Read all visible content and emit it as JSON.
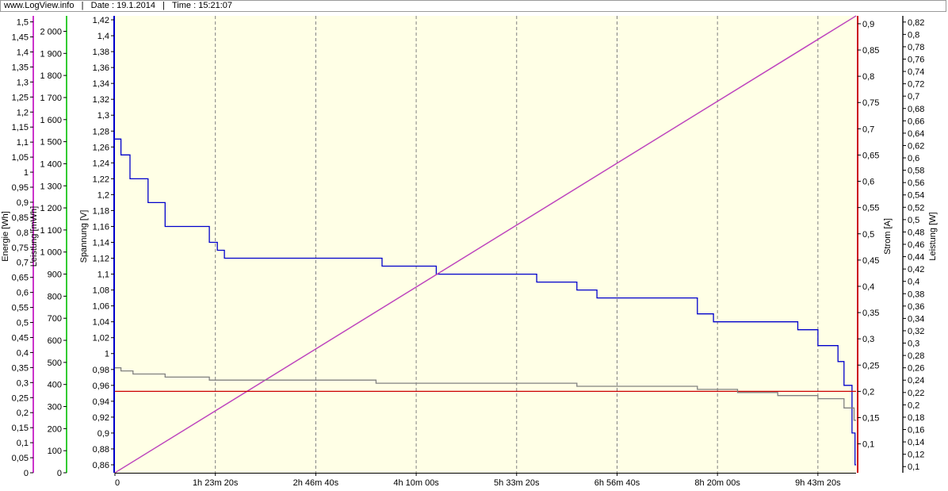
{
  "header": {
    "site": "www.LogView.info",
    "date_label": "Date : 19.1.2014",
    "time_label": "Time : 15:21:07"
  },
  "colors": {
    "plot_bg": "#ffffe6",
    "energie": "#cc33cc",
    "leistung_mwh": "#33cc33",
    "spannung": "#0000cc",
    "strom": "#cc0000",
    "leistung_w": "#808080",
    "grid": "#808080"
  },
  "chart_data": {
    "type": "line",
    "grid": "vertical dashed",
    "x_axis": {
      "tick_labels": [
        "0",
        "1h 23m 20s",
        "2h 46m 40s",
        "4h 10m 00s",
        "5h 33m 20s",
        "6h 56m 40s",
        "8h 20m 00s",
        "9h 43m 20s"
      ],
      "tick_seconds": [
        0,
        5000,
        10000,
        15000,
        20000,
        25000,
        30000,
        35000
      ],
      "range_seconds": [
        0,
        36900
      ]
    },
    "axes": {
      "energie": {
        "label": "Energie [Wh]",
        "range": [
          0,
          1.52
        ],
        "ticks": [
          "0",
          "0,05",
          "0,1",
          "0,15",
          "0,2",
          "0,25",
          "0,3",
          "0,35",
          "0,4",
          "0,45",
          "0,5",
          "0,55",
          "0,6",
          "0,65",
          "0,7",
          "0,75",
          "0,8",
          "0,85",
          "0,9",
          "0,95",
          "1",
          "1,05",
          "1,1",
          "1,15",
          "1,2",
          "1,25",
          "1,3",
          "1,35",
          "1,4",
          "1,45",
          "1,5"
        ]
      },
      "leistung_mwh": {
        "label": "Leistung [mWh]",
        "range": [
          0,
          2070
        ],
        "ticks": [
          "0",
          "100",
          "200",
          "300",
          "400",
          "500",
          "600",
          "700",
          "800",
          "900",
          "1 000",
          "1 100",
          "1 200",
          "1 300",
          "1 400",
          "1 500",
          "1 600",
          "1 700",
          "1 800",
          "1 900",
          "2 000"
        ]
      },
      "spannung": {
        "label": "Spannung [V]",
        "range": [
          0.85,
          1.425
        ],
        "ticks": [
          "0,86",
          "0,88",
          "0,9",
          "0,92",
          "0,94",
          "0,96",
          "0,98",
          "1",
          "1,02",
          "1,04",
          "1,06",
          "1,08",
          "1,1",
          "1,12",
          "1,14",
          "1,16",
          "1,18",
          "1,2",
          "1,22",
          "1,24",
          "1,26",
          "1,28",
          "1,3",
          "1,32",
          "1,34",
          "1,36",
          "1,38",
          "1,4",
          "1,42"
        ]
      },
      "strom": {
        "label": "Strom [A]",
        "range": [
          0.045,
          0.915
        ],
        "ticks": [
          "0,1",
          "0,15",
          "0,2",
          "0,25",
          "0,3",
          "0,35",
          "0,4",
          "0,45",
          "0,5",
          "0,55",
          "0,6",
          "0,65",
          "0,7",
          "0,75",
          "0,8",
          "0,85",
          "0,9"
        ]
      },
      "leistung_w": {
        "label": "Leistung [W]",
        "range": [
          0.09,
          0.83
        ],
        "ticks": [
          "0,1",
          "0,12",
          "0,14",
          "0,16",
          "0,18",
          "0,2",
          "0,22",
          "0,24",
          "0,26",
          "0,28",
          "0,3",
          "0,32",
          "0,34",
          "0,36",
          "0,38",
          "0,4",
          "0,42",
          "0,44",
          "0,46",
          "0,48",
          "0,5",
          "0,52",
          "0,54",
          "0,56",
          "0,58",
          "0,6",
          "0,62",
          "0,64",
          "0,66",
          "0,68",
          "0,7",
          "0,72",
          "0,74",
          "0,76",
          "0,78",
          "0,8",
          "0,82"
        ]
      }
    },
    "series": [
      {
        "axis": "spannung",
        "color_key": "spannung",
        "step": true,
        "points": [
          [
            0,
            1.27
          ],
          [
            300,
            1.25
          ],
          [
            750,
            1.22
          ],
          [
            1650,
            1.19
          ],
          [
            2500,
            1.16
          ],
          [
            4700,
            1.14
          ],
          [
            5100,
            1.13
          ],
          [
            5450,
            1.12
          ],
          [
            13000,
            1.12
          ],
          [
            13300,
            1.11
          ],
          [
            16000,
            1.1
          ],
          [
            21000,
            1.09
          ],
          [
            23000,
            1.08
          ],
          [
            24000,
            1.07
          ],
          [
            29000,
            1.05
          ],
          [
            29800,
            1.04
          ],
          [
            34000,
            1.03
          ],
          [
            35000,
            1.01
          ],
          [
            36000,
            0.99
          ],
          [
            36300,
            0.96
          ],
          [
            36700,
            0.9
          ],
          [
            36850,
            0.86
          ]
        ]
      },
      {
        "axis": "leistung_mwh",
        "color_key": "leistung_mwh",
        "step": false,
        "points": [
          [
            0,
            0
          ],
          [
            36900,
            2070
          ]
        ]
      },
      {
        "axis": "energie",
        "color_key": "energie",
        "step": false,
        "points": [
          [
            0,
            0
          ],
          [
            36900,
            1.52
          ]
        ]
      },
      {
        "axis": "strom",
        "color_key": "strom",
        "step": false,
        "points": [
          [
            0,
            0.2
          ],
          [
            36900,
            0.2
          ]
        ]
      },
      {
        "axis": "leistung_w",
        "color_key": "leistung_w",
        "step": true,
        "points": [
          [
            0,
            0.26
          ],
          [
            300,
            0.255
          ],
          [
            900,
            0.25
          ],
          [
            2500,
            0.245
          ],
          [
            4700,
            0.24
          ],
          [
            13000,
            0.235
          ],
          [
            23000,
            0.23
          ],
          [
            29000,
            0.225
          ],
          [
            31000,
            0.22
          ],
          [
            33000,
            0.215
          ],
          [
            35000,
            0.21
          ],
          [
            36300,
            0.195
          ],
          [
            36800,
            0.175
          ]
        ]
      }
    ]
  }
}
